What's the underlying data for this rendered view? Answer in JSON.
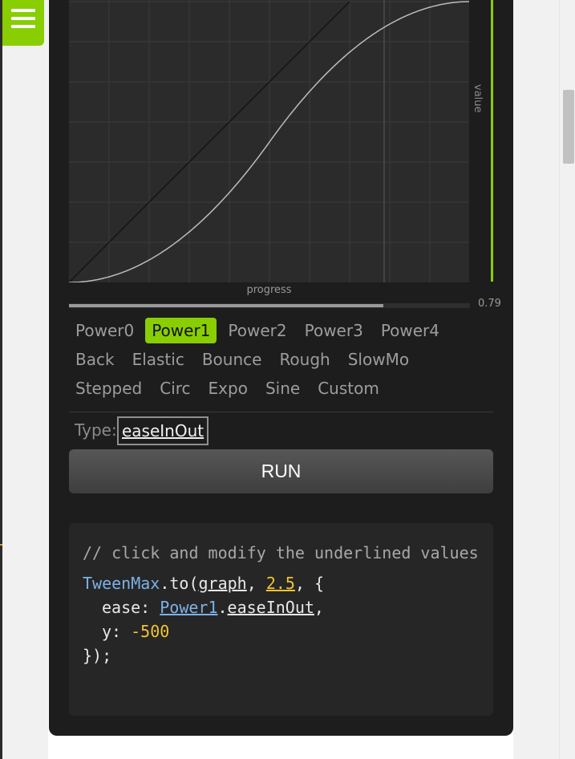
{
  "graph": {
    "axis_value_label": "value",
    "axis_progress_label": "progress",
    "progress_value": "0.79",
    "progress_fraction": 0.79,
    "accent_color": "#88ce02"
  },
  "eases": {
    "rows": [
      [
        "Power0",
        "Power1",
        "Power2",
        "Power3",
        "Power4"
      ],
      [
        "Back",
        "Elastic",
        "Bounce",
        "Rough",
        "SlowMo"
      ],
      [
        "Stepped",
        "Circ",
        "Expo",
        "Sine",
        "Custom"
      ]
    ],
    "selected": "Power1"
  },
  "type": {
    "label": "Type:",
    "value": "easeInOut"
  },
  "run_label": "RUN",
  "code": {
    "comment": "// click and modify the underlined values",
    "line1": {
      "obj": "TweenMax",
      "method": ".to(",
      "target": "graph",
      "sep": ", ",
      "duration": "2.5",
      "tail": ", {"
    },
    "line2": {
      "key": "ease: ",
      "ease": "Power1",
      "dot": ".",
      "type": "easeInOut",
      "tail": ","
    },
    "line3": {
      "key": "y: ",
      "value": "-500"
    },
    "line4": "});"
  },
  "icons": {
    "menu": "hamburger-menu-icon"
  }
}
